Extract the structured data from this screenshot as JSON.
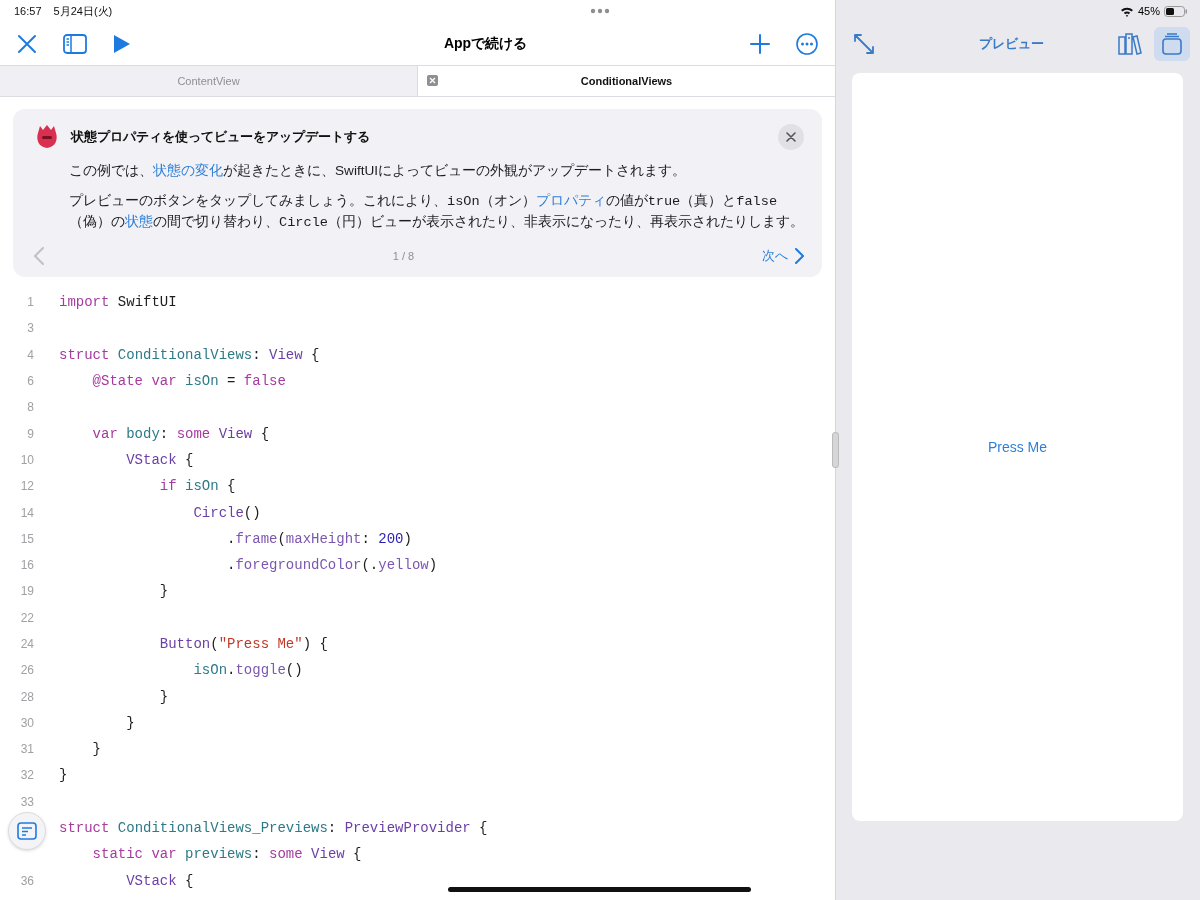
{
  "status_bar": {
    "time": "16:57",
    "date": "5月24日(火)",
    "battery": "45%"
  },
  "toolbar": {
    "title": "Appで続ける"
  },
  "tabs": [
    {
      "label": "ContentView",
      "selected": false,
      "closable": false
    },
    {
      "label": "ConditionalViews",
      "selected": true,
      "closable": true
    }
  ],
  "guide": {
    "title": "状態プロパティを使ってビューをアップデートする",
    "paragraphs": [
      [
        {
          "kind": "text",
          "text": "この例では、"
        },
        {
          "kind": "link",
          "text": "状態の変化"
        },
        {
          "kind": "text",
          "text": "が起きたときに、SwiftUIによってビューの外観がアップデートされます。"
        }
      ],
      [
        {
          "kind": "text",
          "text": "プレビューのボタンをタップしてみましょう。これにより、"
        },
        {
          "kind": "code",
          "text": "isOn"
        },
        {
          "kind": "text",
          "text": "（オン）"
        },
        {
          "kind": "link",
          "text": "プロパティ"
        },
        {
          "kind": "text",
          "text": "の値が"
        },
        {
          "kind": "code",
          "text": "true"
        },
        {
          "kind": "text",
          "text": "（真）と"
        },
        {
          "kind": "code",
          "text": "false"
        },
        {
          "kind": "text",
          "text": "（偽）の"
        },
        {
          "kind": "link",
          "text": "状態"
        },
        {
          "kind": "text",
          "text": "の間で切り替わり、"
        },
        {
          "kind": "code",
          "text": "Circle"
        },
        {
          "kind": "text",
          "text": "（円）ビューが表示されたり、非表示になったり、再表示されたりします。"
        }
      ]
    ],
    "page": "1 / 8",
    "prev_disabled": true,
    "next": "次へ"
  },
  "code": [
    {
      "number": "1",
      "tokens": [
        {
          "kind": "kw",
          "text": "import"
        },
        {
          "kind": "plain",
          "text": " SwiftUI"
        }
      ]
    },
    {
      "number": "3"
    },
    {
      "number": "4",
      "tokens": [
        {
          "kind": "kw",
          "text": "struct"
        },
        {
          "kind": "decl",
          "text": " ConditionalViews"
        },
        {
          "kind": "plain",
          "text": ":"
        },
        {
          "kind": "type",
          "text": " View"
        },
        {
          "kind": "plain",
          "text": " {"
        }
      ]
    },
    {
      "number": "6",
      "tokens": [
        {
          "kind": "attr",
          "text": "    @State"
        },
        {
          "kind": "kw",
          "text": " var"
        },
        {
          "kind": "decl",
          "text": " isOn"
        },
        {
          "kind": "plain",
          "text": " ="
        },
        {
          "kind": "kw",
          "text": " false"
        }
      ]
    },
    {
      "number": "8"
    },
    {
      "number": "9",
      "tokens": [
        {
          "kind": "kw",
          "text": "    var"
        },
        {
          "kind": "decl",
          "text": " body"
        },
        {
          "kind": "plain",
          "text": ":"
        },
        {
          "kind": "kw",
          "text": " some"
        },
        {
          "kind": "type",
          "text": " View"
        },
        {
          "kind": "plain",
          "text": " {"
        }
      ]
    },
    {
      "number": "10",
      "tokens": [
        {
          "kind": "type",
          "text": "        VStack"
        },
        {
          "kind": "plain",
          "text": " {"
        }
      ]
    },
    {
      "number": "12",
      "tokens": [
        {
          "kind": "kw",
          "text": "            if"
        },
        {
          "kind": "decl",
          "text": " isOn"
        },
        {
          "kind": "plain",
          "text": " {"
        }
      ]
    },
    {
      "number": "14",
      "tokens": [
        {
          "kind": "type",
          "text": "                Circle"
        },
        {
          "kind": "plain",
          "text": "()"
        }
      ]
    },
    {
      "number": "15",
      "tokens": [
        {
          "kind": "plain",
          "text": "                    ."
        },
        {
          "kind": "prop",
          "text": "frame"
        },
        {
          "kind": "plain",
          "text": "("
        },
        {
          "kind": "prop",
          "text": "maxHeight"
        },
        {
          "kind": "plain",
          "text": ":"
        },
        {
          "kind": "num",
          "text": " 200"
        },
        {
          "kind": "plain",
          "text": ")"
        }
      ]
    },
    {
      "number": "16",
      "tokens": [
        {
          "kind": "plain",
          "text": "                    ."
        },
        {
          "kind": "prop",
          "text": "foregroundColor"
        },
        {
          "kind": "plain",
          "text": "(."
        },
        {
          "kind": "prop",
          "text": "yellow"
        },
        {
          "kind": "plain",
          "text": ")"
        }
      ]
    },
    {
      "number": "19",
      "tokens": [
        {
          "kind": "plain",
          "text": "            }"
        }
      ]
    },
    {
      "number": "22"
    },
    {
      "number": "24",
      "tokens": [
        {
          "kind": "type",
          "text": "            Button"
        },
        {
          "kind": "plain",
          "text": "("
        },
        {
          "kind": "str",
          "text": "\"Press Me\""
        },
        {
          "kind": "plain",
          "text": ") {"
        }
      ]
    },
    {
      "number": "26",
      "tokens": [
        {
          "kind": "decl",
          "text": "                isOn"
        },
        {
          "kind": "plain",
          "text": "."
        },
        {
          "kind": "prop",
          "text": "toggle"
        },
        {
          "kind": "plain",
          "text": "()"
        }
      ]
    },
    {
      "number": "28",
      "tokens": [
        {
          "kind": "plain",
          "text": "            }"
        }
      ]
    },
    {
      "number": "30",
      "tokens": [
        {
          "kind": "plain",
          "text": "        }"
        }
      ]
    },
    {
      "number": "31",
      "tokens": [
        {
          "kind": "plain",
          "text": "    }"
        }
      ]
    },
    {
      "number": "32",
      "tokens": [
        {
          "kind": "plain",
          "text": "}"
        }
      ]
    },
    {
      "number": "33"
    },
    {
      "tokens": [
        {
          "kind": "kw",
          "text": "struct"
        },
        {
          "kind": "decl",
          "text": " ConditionalViews_Previews"
        },
        {
          "kind": "plain",
          "text": ":"
        },
        {
          "kind": "type",
          "text": " PreviewProvider"
        },
        {
          "kind": "plain",
          "text": " {"
        }
      ]
    },
    {
      "tokens": [
        {
          "kind": "kw",
          "text": "    static"
        },
        {
          "kind": "kw",
          "text": " var"
        },
        {
          "kind": "decl",
          "text": " previews"
        },
        {
          "kind": "plain",
          "text": ":"
        },
        {
          "kind": "kw",
          "text": " some"
        },
        {
          "kind": "type",
          "text": " View"
        },
        {
          "kind": "plain",
          "text": " {"
        }
      ]
    },
    {
      "number": "36",
      "tokens": [
        {
          "kind": "type",
          "text": "        VStack"
        },
        {
          "kind": "plain",
          "text": " {"
        }
      ]
    }
  ],
  "preview": {
    "title": "プレビュー",
    "button": "Press Me",
    "mode_selected": true
  }
}
